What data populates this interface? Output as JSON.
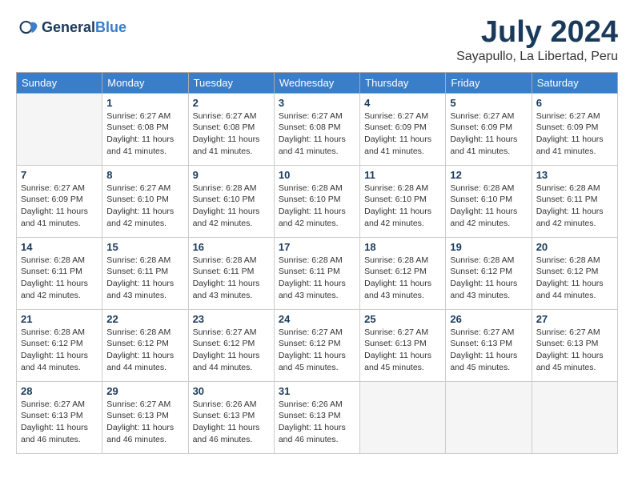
{
  "header": {
    "logo_general": "General",
    "logo_blue": "Blue",
    "month_year": "July 2024",
    "location": "Sayapullo, La Libertad, Peru"
  },
  "weekdays": [
    "Sunday",
    "Monday",
    "Tuesday",
    "Wednesday",
    "Thursday",
    "Friday",
    "Saturday"
  ],
  "weeks": [
    [
      {
        "day": "",
        "sunrise": "",
        "sunset": "",
        "daylight": ""
      },
      {
        "day": "1",
        "sunrise": "Sunrise: 6:27 AM",
        "sunset": "Sunset: 6:08 PM",
        "daylight": "Daylight: 11 hours and 41 minutes."
      },
      {
        "day": "2",
        "sunrise": "Sunrise: 6:27 AM",
        "sunset": "Sunset: 6:08 PM",
        "daylight": "Daylight: 11 hours and 41 minutes."
      },
      {
        "day": "3",
        "sunrise": "Sunrise: 6:27 AM",
        "sunset": "Sunset: 6:08 PM",
        "daylight": "Daylight: 11 hours and 41 minutes."
      },
      {
        "day": "4",
        "sunrise": "Sunrise: 6:27 AM",
        "sunset": "Sunset: 6:09 PM",
        "daylight": "Daylight: 11 hours and 41 minutes."
      },
      {
        "day": "5",
        "sunrise": "Sunrise: 6:27 AM",
        "sunset": "Sunset: 6:09 PM",
        "daylight": "Daylight: 11 hours and 41 minutes."
      },
      {
        "day": "6",
        "sunrise": "Sunrise: 6:27 AM",
        "sunset": "Sunset: 6:09 PM",
        "daylight": "Daylight: 11 hours and 41 minutes."
      }
    ],
    [
      {
        "day": "7",
        "sunrise": "Sunrise: 6:27 AM",
        "sunset": "Sunset: 6:09 PM",
        "daylight": "Daylight: 11 hours and 41 minutes."
      },
      {
        "day": "8",
        "sunrise": "Sunrise: 6:27 AM",
        "sunset": "Sunset: 6:10 PM",
        "daylight": "Daylight: 11 hours and 42 minutes."
      },
      {
        "day": "9",
        "sunrise": "Sunrise: 6:28 AM",
        "sunset": "Sunset: 6:10 PM",
        "daylight": "Daylight: 11 hours and 42 minutes."
      },
      {
        "day": "10",
        "sunrise": "Sunrise: 6:28 AM",
        "sunset": "Sunset: 6:10 PM",
        "daylight": "Daylight: 11 hours and 42 minutes."
      },
      {
        "day": "11",
        "sunrise": "Sunrise: 6:28 AM",
        "sunset": "Sunset: 6:10 PM",
        "daylight": "Daylight: 11 hours and 42 minutes."
      },
      {
        "day": "12",
        "sunrise": "Sunrise: 6:28 AM",
        "sunset": "Sunset: 6:10 PM",
        "daylight": "Daylight: 11 hours and 42 minutes."
      },
      {
        "day": "13",
        "sunrise": "Sunrise: 6:28 AM",
        "sunset": "Sunset: 6:11 PM",
        "daylight": "Daylight: 11 hours and 42 minutes."
      }
    ],
    [
      {
        "day": "14",
        "sunrise": "Sunrise: 6:28 AM",
        "sunset": "Sunset: 6:11 PM",
        "daylight": "Daylight: 11 hours and 42 minutes."
      },
      {
        "day": "15",
        "sunrise": "Sunrise: 6:28 AM",
        "sunset": "Sunset: 6:11 PM",
        "daylight": "Daylight: 11 hours and 43 minutes."
      },
      {
        "day": "16",
        "sunrise": "Sunrise: 6:28 AM",
        "sunset": "Sunset: 6:11 PM",
        "daylight": "Daylight: 11 hours and 43 minutes."
      },
      {
        "day": "17",
        "sunrise": "Sunrise: 6:28 AM",
        "sunset": "Sunset: 6:11 PM",
        "daylight": "Daylight: 11 hours and 43 minutes."
      },
      {
        "day": "18",
        "sunrise": "Sunrise: 6:28 AM",
        "sunset": "Sunset: 6:12 PM",
        "daylight": "Daylight: 11 hours and 43 minutes."
      },
      {
        "day": "19",
        "sunrise": "Sunrise: 6:28 AM",
        "sunset": "Sunset: 6:12 PM",
        "daylight": "Daylight: 11 hours and 43 minutes."
      },
      {
        "day": "20",
        "sunrise": "Sunrise: 6:28 AM",
        "sunset": "Sunset: 6:12 PM",
        "daylight": "Daylight: 11 hours and 44 minutes."
      }
    ],
    [
      {
        "day": "21",
        "sunrise": "Sunrise: 6:28 AM",
        "sunset": "Sunset: 6:12 PM",
        "daylight": "Daylight: 11 hours and 44 minutes."
      },
      {
        "day": "22",
        "sunrise": "Sunrise: 6:28 AM",
        "sunset": "Sunset: 6:12 PM",
        "daylight": "Daylight: 11 hours and 44 minutes."
      },
      {
        "day": "23",
        "sunrise": "Sunrise: 6:27 AM",
        "sunset": "Sunset: 6:12 PM",
        "daylight": "Daylight: 11 hours and 44 minutes."
      },
      {
        "day": "24",
        "sunrise": "Sunrise: 6:27 AM",
        "sunset": "Sunset: 6:12 PM",
        "daylight": "Daylight: 11 hours and 45 minutes."
      },
      {
        "day": "25",
        "sunrise": "Sunrise: 6:27 AM",
        "sunset": "Sunset: 6:13 PM",
        "daylight": "Daylight: 11 hours and 45 minutes."
      },
      {
        "day": "26",
        "sunrise": "Sunrise: 6:27 AM",
        "sunset": "Sunset: 6:13 PM",
        "daylight": "Daylight: 11 hours and 45 minutes."
      },
      {
        "day": "27",
        "sunrise": "Sunrise: 6:27 AM",
        "sunset": "Sunset: 6:13 PM",
        "daylight": "Daylight: 11 hours and 45 minutes."
      }
    ],
    [
      {
        "day": "28",
        "sunrise": "Sunrise: 6:27 AM",
        "sunset": "Sunset: 6:13 PM",
        "daylight": "Daylight: 11 hours and 46 minutes."
      },
      {
        "day": "29",
        "sunrise": "Sunrise: 6:27 AM",
        "sunset": "Sunset: 6:13 PM",
        "daylight": "Daylight: 11 hours and 46 minutes."
      },
      {
        "day": "30",
        "sunrise": "Sunrise: 6:26 AM",
        "sunset": "Sunset: 6:13 PM",
        "daylight": "Daylight: 11 hours and 46 minutes."
      },
      {
        "day": "31",
        "sunrise": "Sunrise: 6:26 AM",
        "sunset": "Sunset: 6:13 PM",
        "daylight": "Daylight: 11 hours and 46 minutes."
      },
      {
        "day": "",
        "sunrise": "",
        "sunset": "",
        "daylight": ""
      },
      {
        "day": "",
        "sunrise": "",
        "sunset": "",
        "daylight": ""
      },
      {
        "day": "",
        "sunrise": "",
        "sunset": "",
        "daylight": ""
      }
    ]
  ]
}
